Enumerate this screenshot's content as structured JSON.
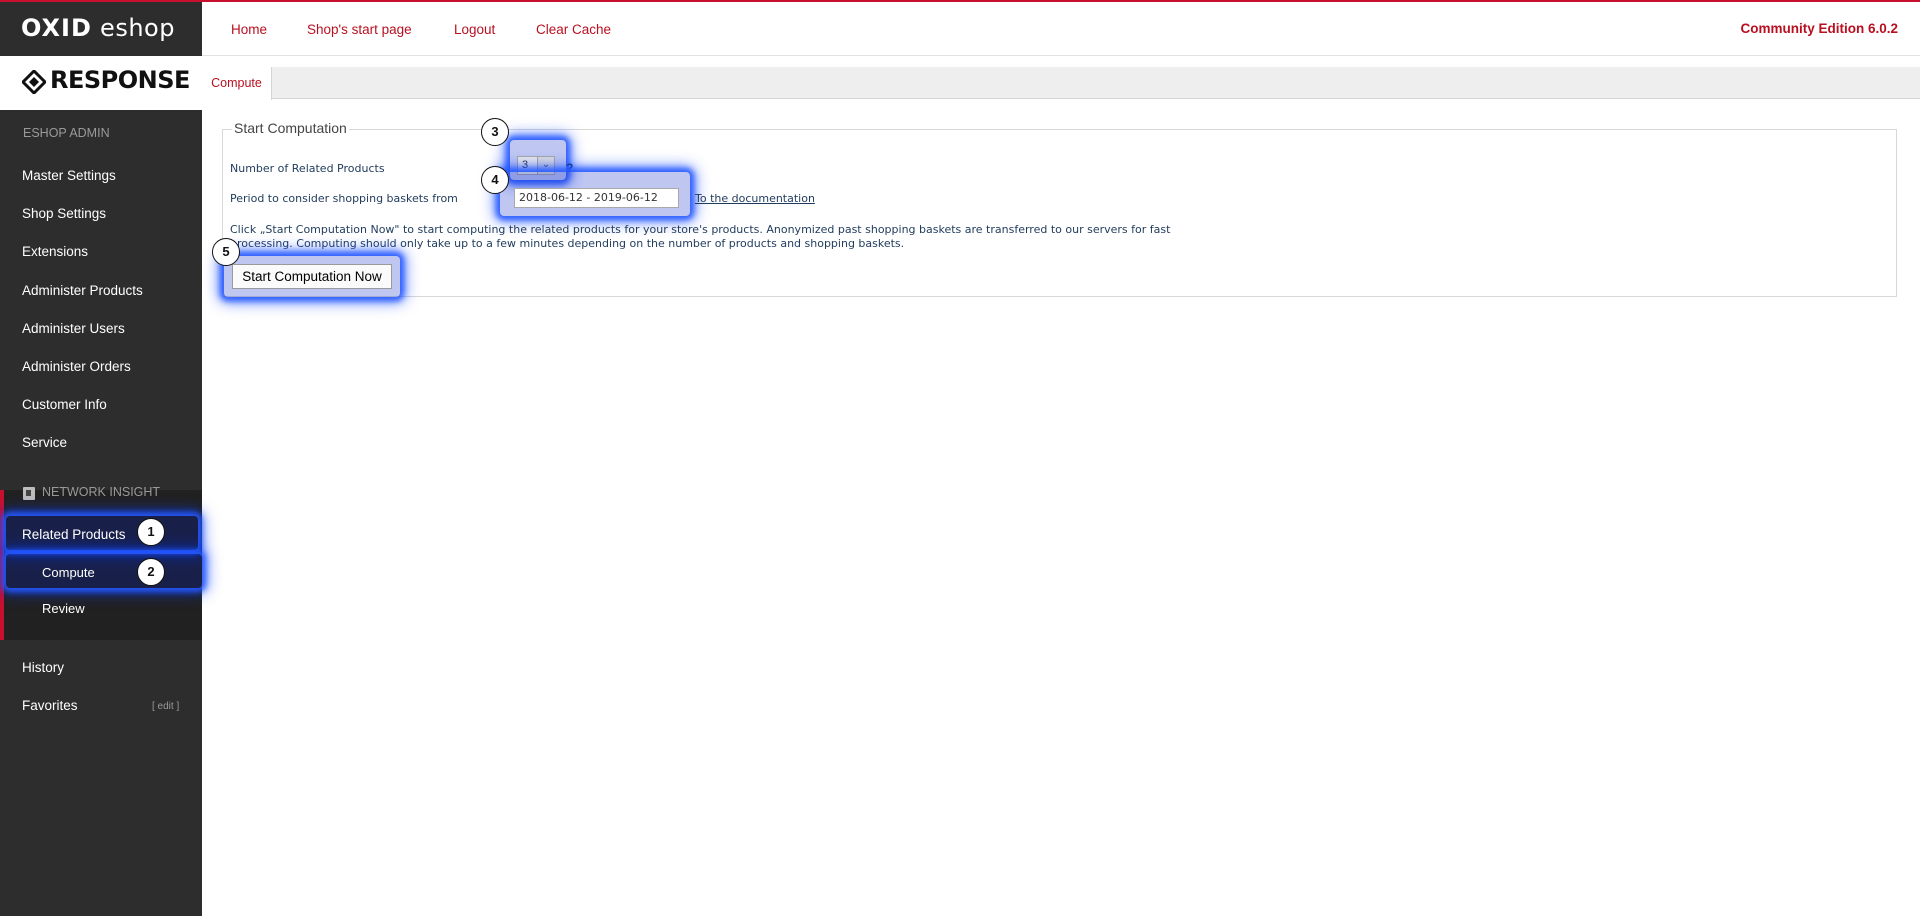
{
  "brand": {
    "oxid": "OXID",
    "eshop": "eshop",
    "response": "RESPONSE"
  },
  "header": {
    "links": [
      "Home",
      "Shop's start page",
      "Logout",
      "Clear Cache"
    ],
    "edition": "Community Edition 6.0.2"
  },
  "sidebar": {
    "heading": "ESHOP ADMIN",
    "items": [
      "Master Settings",
      "Shop Settings",
      "Extensions",
      "Administer Products",
      "Administer Users",
      "Administer Orders",
      "Customer Info",
      "Service"
    ],
    "network_heading": "NETWORK INSIGHT",
    "network_item": "Related Products",
    "network_subs": [
      "Compute",
      "Review"
    ],
    "history": "History",
    "favorites": "Favorites",
    "favorites_edit": "[ edit ]"
  },
  "tabs": {
    "active": "Compute"
  },
  "form": {
    "legend": "Start Computation",
    "related_label": "Number of Related Products",
    "related_value": "3",
    "help": "?",
    "period_label": "Period to consider shopping baskets from",
    "period_value": "2018-06-12 - 2019-06-12",
    "doc_link": "To the documentation",
    "description": "Click „Start Computation Now\" to start computing the related products for your store's products. Anonymized past shopping baskets are transferred to our servers for fast processing. Computing should only take up to a few minutes depending on the number of products and shopping baskets.",
    "button": "Start Computation Now"
  },
  "badges": [
    "1",
    "2",
    "3",
    "4",
    "5"
  ],
  "colors": {
    "accent": "#b81021",
    "sidebar_bg": "#2d2d2d",
    "highlight": "#1f5bff"
  }
}
